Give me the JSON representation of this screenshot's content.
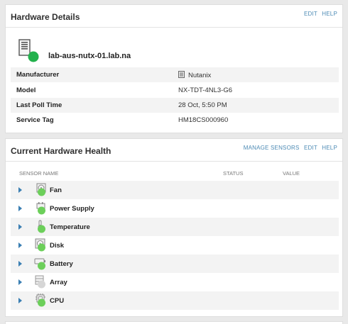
{
  "hardware_details": {
    "title": "Hardware Details",
    "actions": {
      "edit": "EDIT",
      "help": "HELP"
    },
    "device_name": "lab-aus-nutx-01.lab.na",
    "status_color": "#22b14c",
    "rows": [
      {
        "label": "Manufacturer",
        "value": "Nutanix"
      },
      {
        "label": "Model",
        "value": "NX-TDT-4NL3-G6"
      },
      {
        "label": "Last Poll Time",
        "value": "28 Oct, 5:50 PM"
      },
      {
        "label": "Service Tag",
        "value": "HM18CS000960"
      }
    ]
  },
  "hardware_health": {
    "title": "Current Hardware Health",
    "actions": {
      "manage_sensors": "MANAGE SENSORS",
      "edit": "EDIT",
      "help": "HELP"
    },
    "columns": {
      "sensor_name": "SENSOR NAME",
      "status": "STATUS",
      "value": "VALUE"
    },
    "sensors": [
      {
        "label": "Fan",
        "icon": "fan-icon",
        "status": "up",
        "status_color": "#6ccf5a"
      },
      {
        "label": "Power Supply",
        "icon": "power-supply-icon",
        "status": "up",
        "status_color": "#6ccf5a"
      },
      {
        "label": "Temperature",
        "icon": "thermometer-icon",
        "status": "up",
        "status_color": "#6ccf5a"
      },
      {
        "label": "Disk",
        "icon": "disk-icon",
        "status": "up",
        "status_color": "#6ccf5a"
      },
      {
        "label": "Battery",
        "icon": "battery-icon",
        "status": "up",
        "status_color": "#6ccf5a"
      },
      {
        "label": "Array",
        "icon": "array-icon",
        "status": "unknown",
        "status_color": "#d6d6d6"
      },
      {
        "label": "CPU",
        "icon": "cpu-icon",
        "status": "up",
        "status_color": "#6ccf5a"
      }
    ]
  },
  "colors": {
    "accent_link": "#4d8bb5",
    "expander": "#3b7fb3",
    "status_up": "#6ccf5a",
    "status_unknown": "#d6d6d6"
  }
}
